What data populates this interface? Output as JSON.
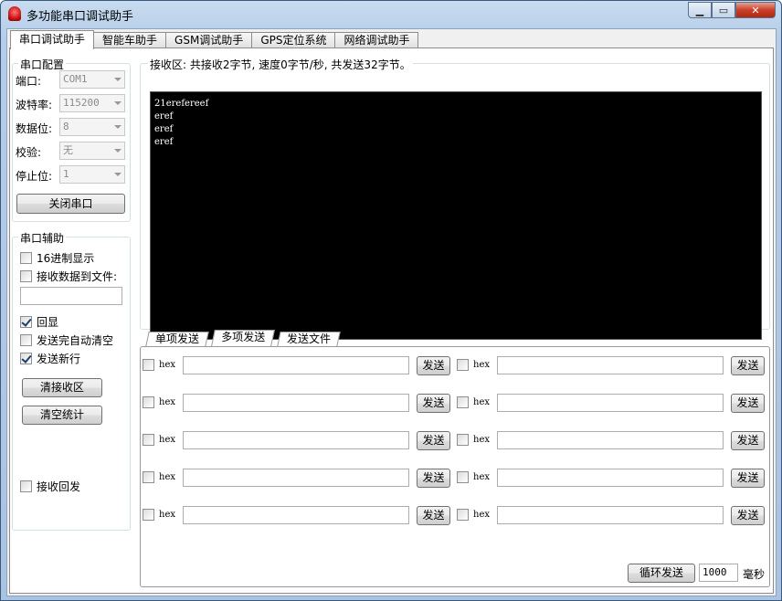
{
  "window": {
    "title": "多功能串口调试助手",
    "min_icon": "minimize-icon",
    "max_icon": "maximize-icon",
    "close_icon": "close-icon"
  },
  "tabs": [
    "串口调试助手",
    "智能车助手",
    "GSM调试助手",
    "GPS定位系统",
    "网络调试助手"
  ],
  "serial_config": {
    "title": "串口配置",
    "port_label": "端口:",
    "port_value": "COM1",
    "baud_label": "波特率:",
    "baud_value": "115200",
    "databits_label": "数据位:",
    "databits_value": "8",
    "parity_label": "校验:",
    "parity_value": "无",
    "stopbits_label": "停止位:",
    "stopbits_value": "1",
    "close_button": "关闭串口"
  },
  "serial_assist": {
    "title": "串口辅助",
    "hex_display": "16进制显示",
    "save_to_file": "接收数据到文件:",
    "file_path": "",
    "echo": "回显",
    "auto_clear": "发送完自动清空",
    "newline": "发送新行",
    "clear_rx_button": "清接收区",
    "clear_stats_button": "清空统计",
    "rx_reply": "接收回发"
  },
  "receive": {
    "status": "接收区: 共接收2字节, 速度0字节/秒, 共发送32字节。",
    "content": "21erefereef\neref\neref\neref"
  },
  "send_tabs": [
    "单项发送",
    "多项发送",
    "发送文件"
  ],
  "multi_send": {
    "hex_label": "hex",
    "send_button": "发送"
  },
  "loop": {
    "button": "循环发送",
    "interval": "1000",
    "unit": "毫秒"
  }
}
